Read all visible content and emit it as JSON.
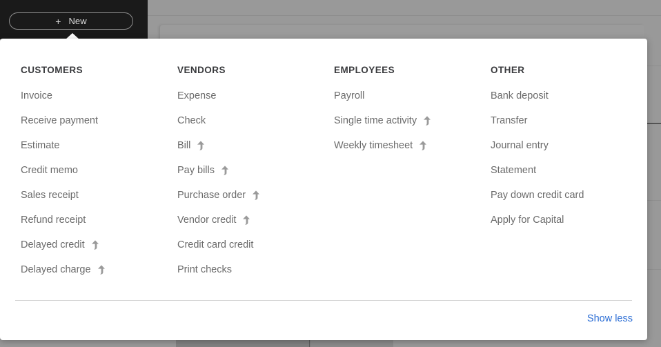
{
  "colors": {
    "accent_link": "#2c6ed5",
    "sidebar_bg": "#1a1a1a",
    "panel_bg": "#ffffff",
    "backdrop": "#999999",
    "heading_text": "#393a3d",
    "item_text": "#6b6b6b"
  },
  "sidebar": {
    "new_button": {
      "plus": "+",
      "label": "New",
      "icon": "plus-icon"
    }
  },
  "panel": {
    "columns": [
      {
        "id": "customers",
        "heading": "CUSTOMERS",
        "items": [
          {
            "label": "Invoice",
            "arrow": false
          },
          {
            "label": "Receive payment",
            "arrow": false
          },
          {
            "label": "Estimate",
            "arrow": false
          },
          {
            "label": "Credit memo",
            "arrow": false
          },
          {
            "label": "Sales receipt",
            "arrow": false
          },
          {
            "label": "Refund receipt",
            "arrow": false
          },
          {
            "label": "Delayed credit",
            "arrow": true
          },
          {
            "label": "Delayed charge",
            "arrow": true
          }
        ]
      },
      {
        "id": "vendors",
        "heading": "VENDORS",
        "items": [
          {
            "label": "Expense",
            "arrow": false
          },
          {
            "label": "Check",
            "arrow": false
          },
          {
            "label": "Bill",
            "arrow": true
          },
          {
            "label": "Pay bills",
            "arrow": true
          },
          {
            "label": "Purchase order",
            "arrow": true
          },
          {
            "label": "Vendor credit",
            "arrow": true
          },
          {
            "label": "Credit card credit",
            "arrow": false
          },
          {
            "label": "Print checks",
            "arrow": false
          }
        ]
      },
      {
        "id": "employees",
        "heading": "EMPLOYEES",
        "items": [
          {
            "label": "Payroll",
            "arrow": false
          },
          {
            "label": "Single time activity",
            "arrow": true
          },
          {
            "label": "Weekly timesheet",
            "arrow": true
          }
        ]
      },
      {
        "id": "other",
        "heading": "OTHER",
        "items": [
          {
            "label": "Bank deposit",
            "arrow": false
          },
          {
            "label": "Transfer",
            "arrow": false
          },
          {
            "label": "Journal entry",
            "arrow": false
          },
          {
            "label": "Statement",
            "arrow": false
          },
          {
            "label": "Pay down credit card",
            "arrow": false
          },
          {
            "label": "Apply for Capital",
            "arrow": false
          }
        ]
      }
    ],
    "footer": {
      "show_less_label": "Show less"
    }
  }
}
